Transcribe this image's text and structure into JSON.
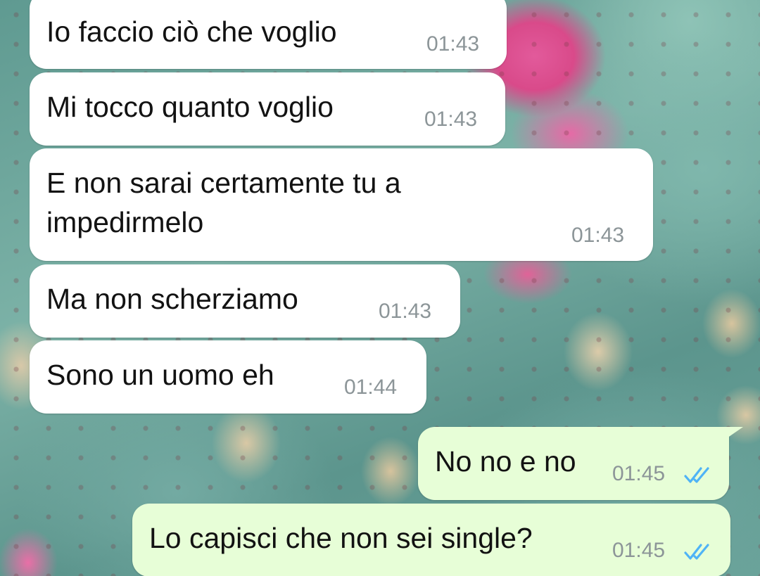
{
  "chat": {
    "messages": [
      {
        "text": "Io faccio ciò che voglio",
        "time": "01:43",
        "direction": "incoming"
      },
      {
        "text": "Mi tocco quanto voglio",
        "time": "01:43",
        "direction": "incoming"
      },
      {
        "text_lines": [
          "E non sarai certamente tu a",
          "impedirmelo"
        ],
        "time": "01:43",
        "direction": "incoming"
      },
      {
        "text": "Ma non scherziamo",
        "time": "01:43",
        "direction": "incoming"
      },
      {
        "text": "Sono un uomo eh",
        "time": "01:44",
        "direction": "incoming"
      },
      {
        "text": "No no e no",
        "time": "01:45",
        "direction": "outgoing",
        "status_icon": "double-check-icon"
      },
      {
        "text": "Lo capisci che non sei single?",
        "time": "01:45",
        "direction": "outgoing",
        "status_icon": "double-check-icon"
      }
    ]
  },
  "colors": {
    "incoming_bubble": "#ffffff",
    "outgoing_bubble": "#e7fed7",
    "text": "#121212",
    "time": "#8c9598",
    "read_ticks": "#4fb3f6"
  }
}
